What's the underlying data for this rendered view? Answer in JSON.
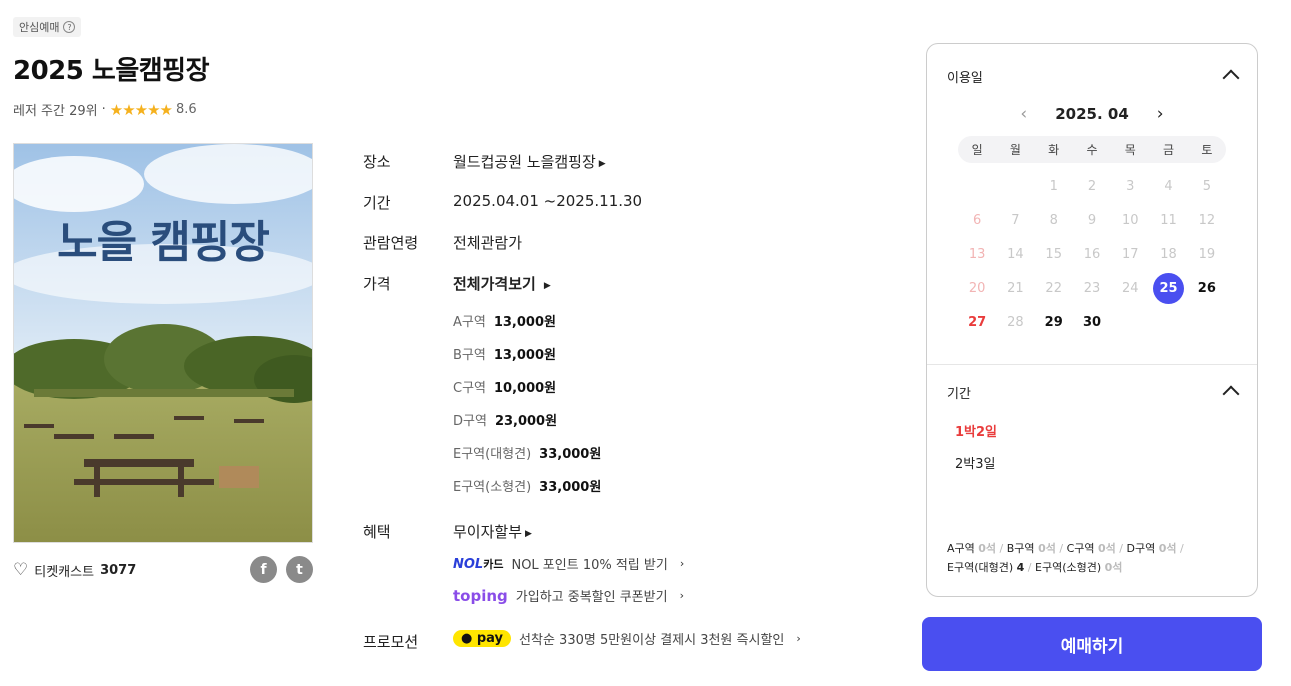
{
  "badge": {
    "label": "안심예매",
    "icon": "question-circle-icon"
  },
  "title": "2025 노을캠핑장",
  "rank": {
    "text": "레저 주간 29위",
    "separator": "·",
    "stars": "★★★★★",
    "score": "8.6"
  },
  "poster": {
    "title": "노을 캠핑장"
  },
  "likes": {
    "label": "티켓캐스트",
    "count": "3077"
  },
  "share": {
    "facebook": "f",
    "twitter": "t"
  },
  "info": {
    "place_label": "장소",
    "place_value": "월드컵공원 노을캠핑장",
    "period_label": "기간",
    "period_value": "2025.04.01 ~2025.11.30",
    "age_label": "관람연령",
    "age_value": "전체관람가",
    "price_label": "가격",
    "price_value": "전체가격보기",
    "benefit_label": "혜택",
    "benefit_value": "무이자할부",
    "promo_label": "프로모션"
  },
  "prices": [
    {
      "zone": "A구역",
      "amount": "13,000원"
    },
    {
      "zone": "B구역",
      "amount": "13,000원"
    },
    {
      "zone": "C구역",
      "amount": "10,000원"
    },
    {
      "zone": "D구역",
      "amount": "23,000원"
    },
    {
      "zone": "E구역(대형견)",
      "amount": "33,000원"
    },
    {
      "zone": "E구역(소형견)",
      "amount": "33,000원"
    }
  ],
  "benefits": {
    "nol_logo": "NOL",
    "nol_card": "카드",
    "nol_text": "NOL 포인트 10% 적립 받기",
    "toping_logo": "toping",
    "toping_text": "가입하고 중복할인 쿠폰받기",
    "kpay_logo": "pay",
    "kpay_text": "선착순 330명 5만원이상 결제시 3천원 즉시할인",
    "chevron": "›"
  },
  "calendar": {
    "section_label": "이용일",
    "month": "2025. 04",
    "prev": "‹",
    "next": "›",
    "weekdays": [
      "일",
      "월",
      "화",
      "수",
      "목",
      "금",
      "토"
    ],
    "leading_blanks": 2,
    "days": [
      {
        "d": "1",
        "s": "dis"
      },
      {
        "d": "2",
        "s": "dis"
      },
      {
        "d": "3",
        "s": "dis"
      },
      {
        "d": "4",
        "s": "dis"
      },
      {
        "d": "5",
        "s": "dis"
      },
      {
        "d": "6",
        "s": "sun-dis"
      },
      {
        "d": "7",
        "s": "dis"
      },
      {
        "d": "8",
        "s": "dis"
      },
      {
        "d": "9",
        "s": "dis"
      },
      {
        "d": "10",
        "s": "dis"
      },
      {
        "d": "11",
        "s": "dis"
      },
      {
        "d": "12",
        "s": "dis"
      },
      {
        "d": "13",
        "s": "sun-dis"
      },
      {
        "d": "14",
        "s": "dis"
      },
      {
        "d": "15",
        "s": "dis"
      },
      {
        "d": "16",
        "s": "dis"
      },
      {
        "d": "17",
        "s": "dis"
      },
      {
        "d": "18",
        "s": "dis"
      },
      {
        "d": "19",
        "s": "dis"
      },
      {
        "d": "20",
        "s": "sun-dis"
      },
      {
        "d": "21",
        "s": "dis"
      },
      {
        "d": "22",
        "s": "dis"
      },
      {
        "d": "23",
        "s": "dis"
      },
      {
        "d": "24",
        "s": "dis"
      },
      {
        "d": "25",
        "s": "sel"
      },
      {
        "d": "26",
        "s": "act"
      },
      {
        "d": "27",
        "s": "sun"
      },
      {
        "d": "28",
        "s": "dis"
      },
      {
        "d": "29",
        "s": "act"
      },
      {
        "d": "30",
        "s": "act"
      }
    ]
  },
  "period_section": {
    "label": "기간",
    "options": [
      "1박2일",
      "2박3일"
    ],
    "selected": "1박2일"
  },
  "seats": [
    {
      "zone": "A구역",
      "count": "0석"
    },
    {
      "zone": "B구역",
      "count": "0석"
    },
    {
      "zone": "C구역",
      "count": "0석"
    },
    {
      "zone": "D구역",
      "count": "0석"
    },
    {
      "zone": "E구역(대형견)",
      "count": "4"
    },
    {
      "zone": "E구역(소형견)",
      "count": "0석"
    }
  ],
  "book_button": "예매하기",
  "colors": {
    "accent": "#4a4ff0",
    "sunday": "#e93c3c",
    "star": "#f5b11e",
    "kpay": "#ffe500",
    "nol": "#2a3fd9",
    "toping": "#8a4de8"
  }
}
